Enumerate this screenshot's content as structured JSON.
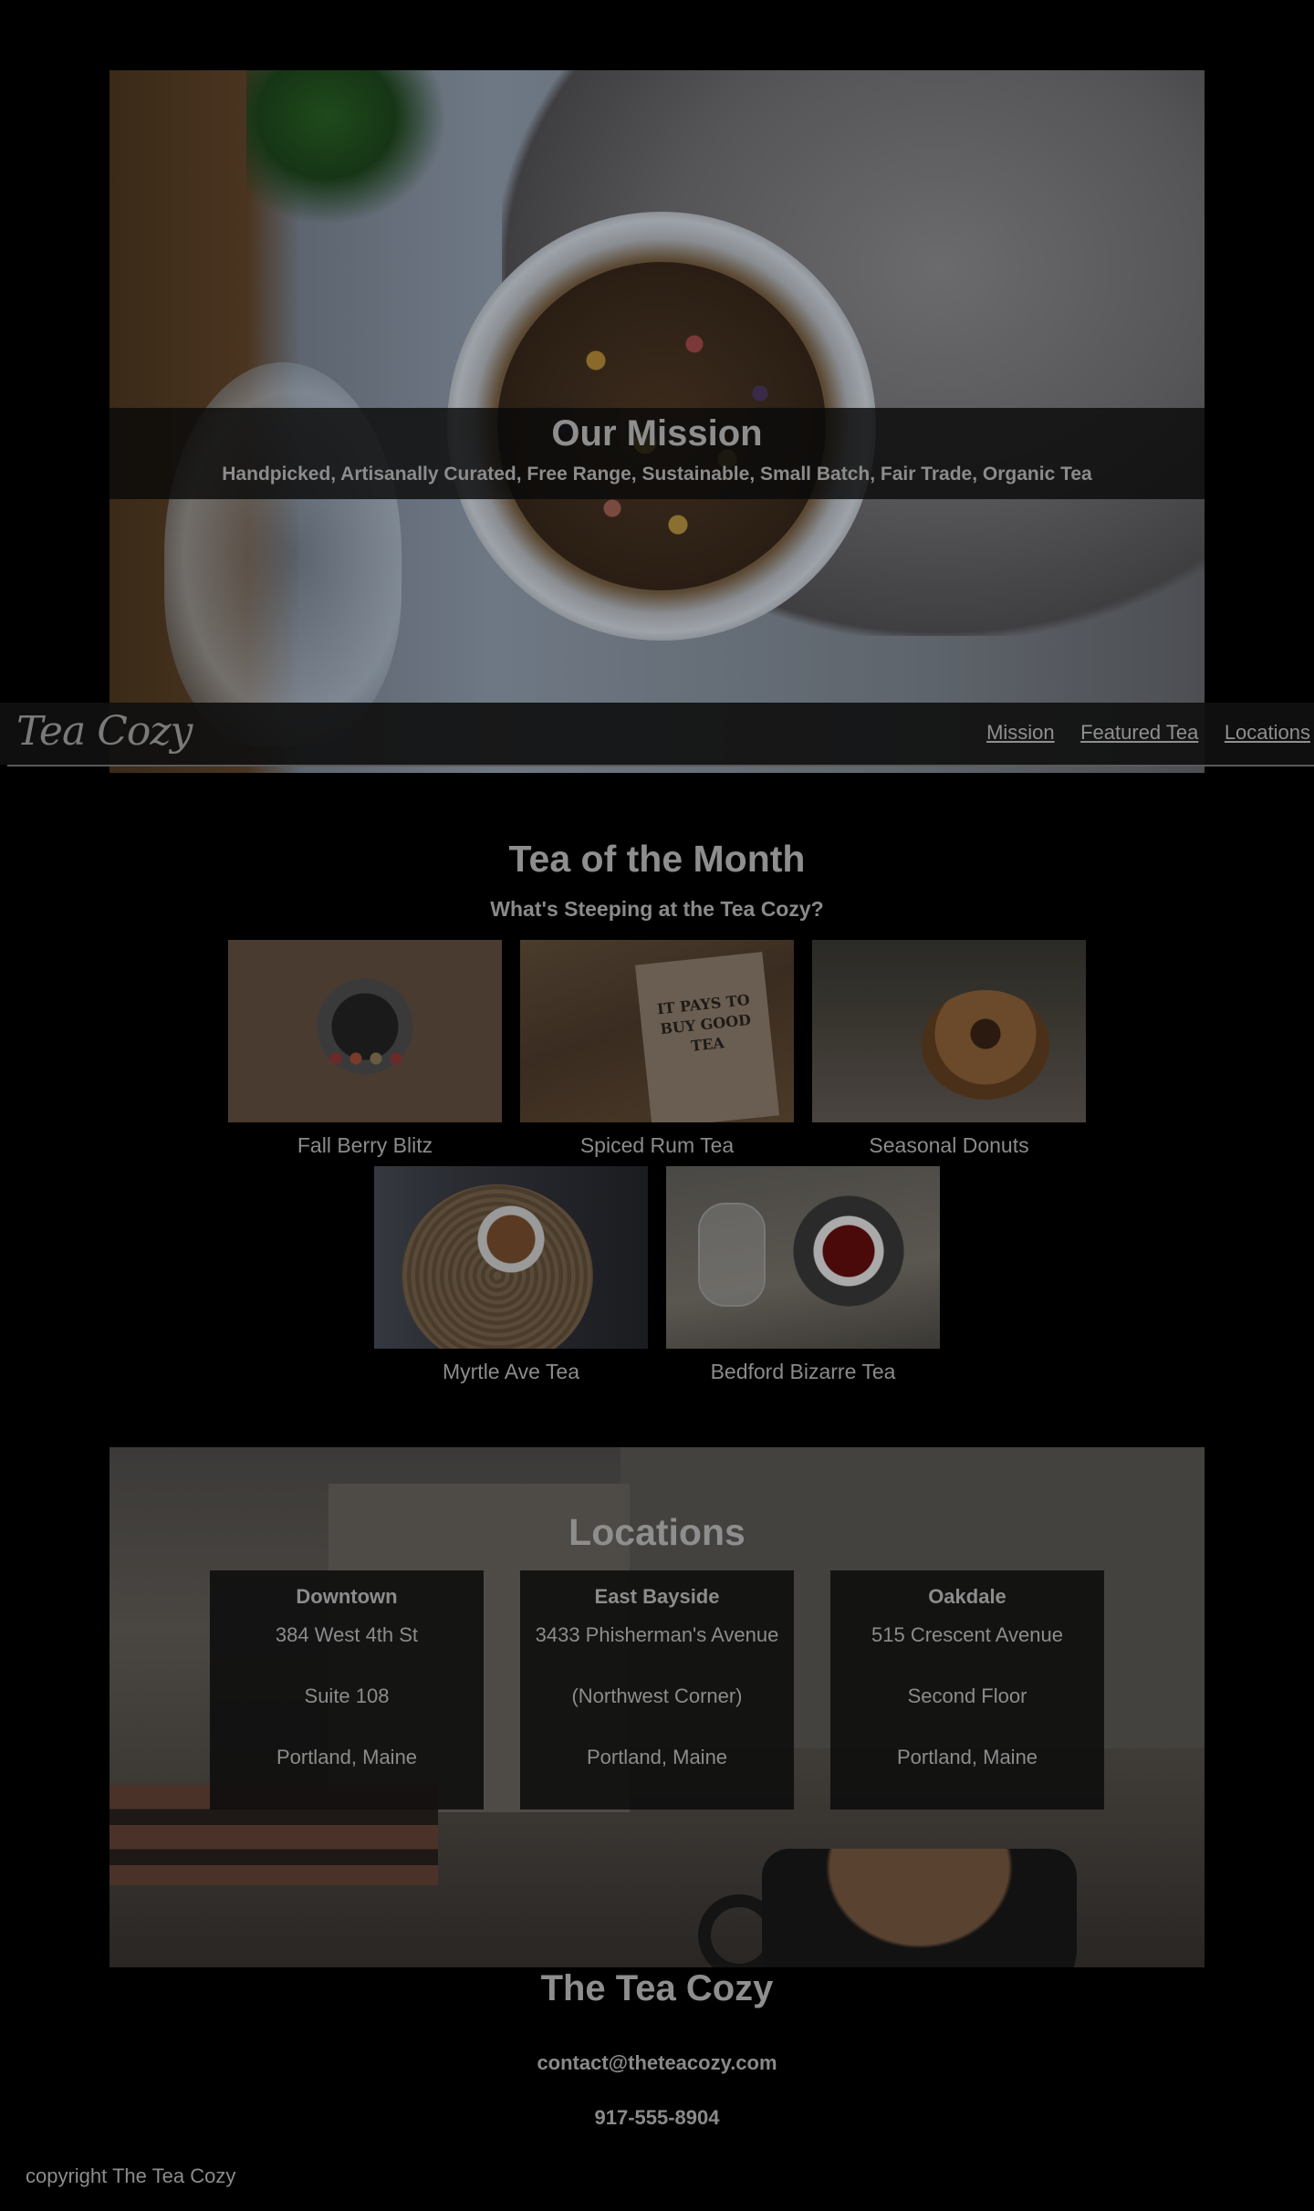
{
  "header": {
    "logo": "Tea Cozy",
    "nav": [
      "Mission",
      "Featured Tea",
      "Locations"
    ]
  },
  "mission": {
    "title": "Our Mission",
    "subtitle": "Handpicked, Artisanally Curated, Free Range, Sustainable, Small Batch, Fair Trade, Organic Tea"
  },
  "tea_of_month": {
    "title": "Tea of the Month",
    "subtitle": "What's Steeping at the Tea Cozy?",
    "items": [
      {
        "caption": "Fall Berry Blitz"
      },
      {
        "caption": "Spiced Rum Tea",
        "box_text": "IT PAYS TO BUY GOOD TEA"
      },
      {
        "caption": "Seasonal Donuts"
      },
      {
        "caption": "Myrtle Ave Tea"
      },
      {
        "caption": "Bedford Bizarre Tea"
      }
    ]
  },
  "locations": {
    "title": "Locations",
    "cards": [
      {
        "name": "Downtown",
        "line1": "384 West 4th St",
        "line2": "Suite 108",
        "line3": "Portland, Maine"
      },
      {
        "name": "East Bayside",
        "line1": "3433 Phisherman's Avenue",
        "line2": "(Northwest Corner)",
        "line3": "Portland, Maine"
      },
      {
        "name": "Oakdale",
        "line1": "515 Crescent Avenue",
        "line2": "Second Floor",
        "line3": "Portland, Maine"
      }
    ]
  },
  "footer": {
    "title": "The Tea Cozy",
    "email": "contact@theteacozy.com",
    "phone": "917-555-8904",
    "copyright": "copyright The Tea Cozy"
  },
  "colors": {
    "background": "#000000",
    "text": "#8f8f8f",
    "overlay": "#0a0a0a"
  }
}
